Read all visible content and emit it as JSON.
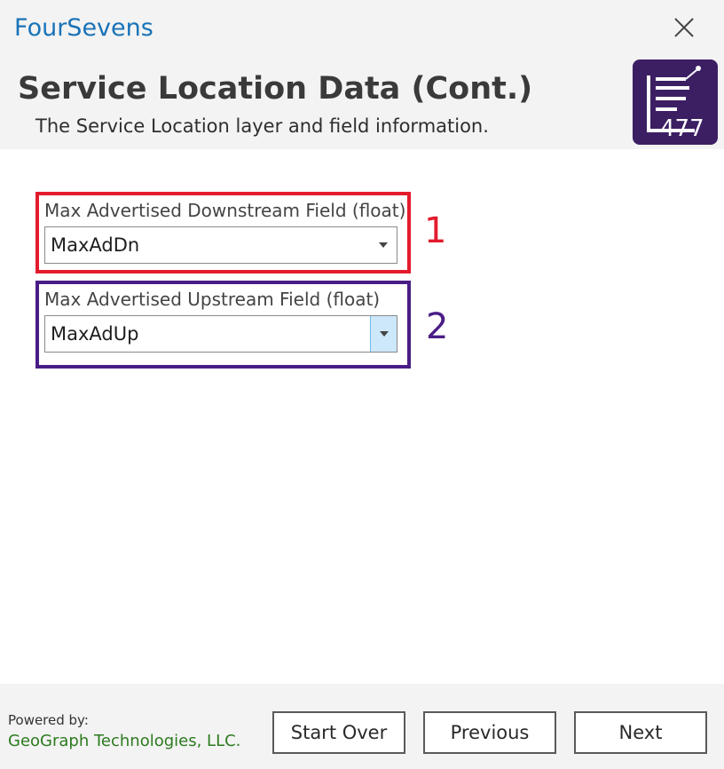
{
  "app": {
    "title": "FourSevens",
    "close_icon": "close-icon"
  },
  "header": {
    "title": "Service Location Data (Cont.)",
    "subtitle": "The Service Location layer and field information.",
    "logo_text": "477",
    "logo_color": "#3c1f63"
  },
  "fields": [
    {
      "label": "Max Advertised Downstream Field (float)",
      "value": "MaxAdDn",
      "annotation": "1",
      "annotation_color": "#e31b2d"
    },
    {
      "label": "Max Advertised Upstream Field (float)",
      "value": "MaxAdUp",
      "annotation": "2",
      "annotation_color": "#4a1d86"
    }
  ],
  "footer": {
    "powered_label": "Powered by:",
    "company": "GeoGraph Technologies, LLC.",
    "buttons": {
      "start_over": "Start Over",
      "previous": "Previous",
      "next": "Next"
    }
  }
}
